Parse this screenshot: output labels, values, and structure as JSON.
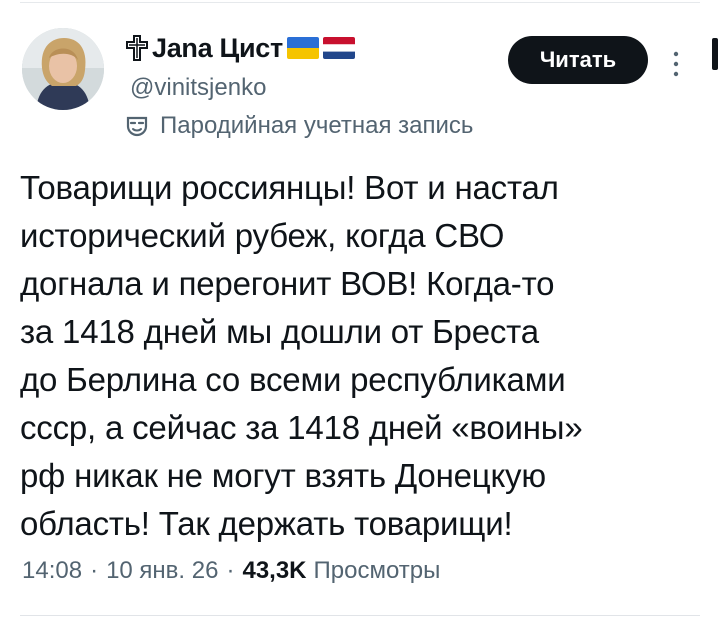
{
  "account": {
    "display_name": "Jana Цист",
    "handle": "@vinitsjenko",
    "parody_label": "Пародийная учетная запись"
  },
  "actions": {
    "follow_label": "Читать"
  },
  "tweet": {
    "lines": [
      "Товарищи россиянцы! Вот и настал",
      "исторический рубеж, когда СВО",
      "догнала и перегонит ВОВ! Когда-то",
      "за 1418 дней мы дошли от Бреста",
      "до Берлина со всеми республиками",
      "ссср, а сейчас за 1418 дней «воины»",
      "рф никак не могут взять Донецкую",
      "область! Так держать товарищи!"
    ]
  },
  "meta": {
    "time": "14:08",
    "date": "10 янв. 26",
    "views_count": "43,3K",
    "views_label": "Просмотры",
    "separator": "·"
  },
  "icons": {
    "name_prefix": "cross-icon",
    "flags": [
      "ukraine-flag-icon",
      "netherlands-flag-icon"
    ],
    "parody": "mask-icon",
    "more": "more-vertical-icon"
  },
  "colors": {
    "text": "#0f1419",
    "secondary": "#536471",
    "button_bg": "#0f1419",
    "button_text": "#ffffff"
  }
}
